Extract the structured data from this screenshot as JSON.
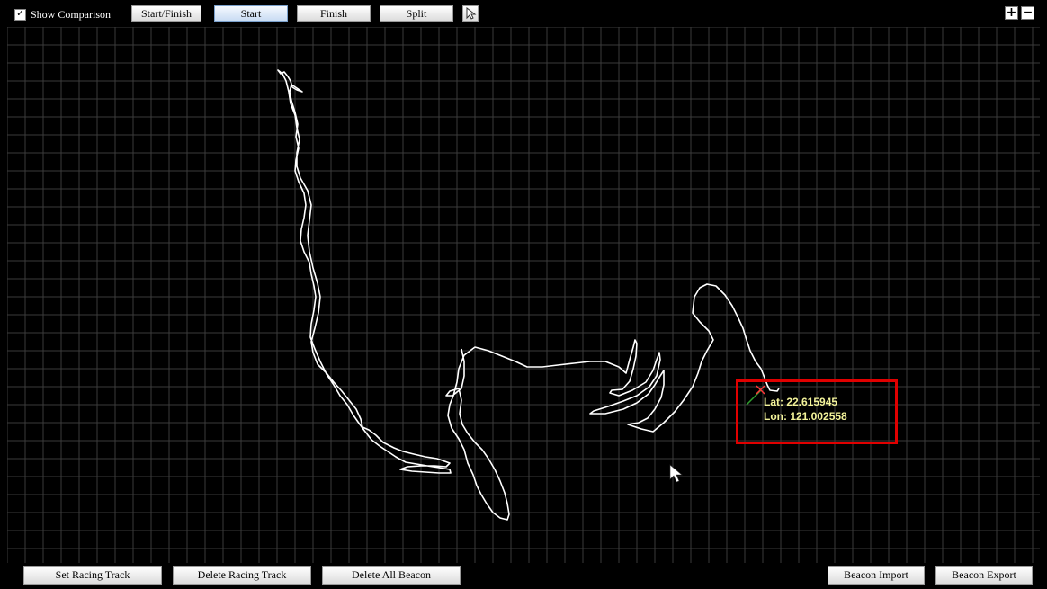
{
  "toolbar": {
    "show_comparison": {
      "label": "Show Comparison",
      "checked": true
    },
    "buttons": {
      "start_finish": "Start/Finish",
      "start": "Start",
      "finish": "Finish",
      "split": "Split"
    },
    "active_button": "Start",
    "zoom_in_icon": "plus-icon",
    "zoom_out_icon": "minus-icon",
    "pointer_tool_icon": "arrow-cursor-icon"
  },
  "map": {
    "grid": true,
    "background": "#000000",
    "grid_color": "#3a3a3a",
    "track_color": "#ffffff",
    "selection_box_color": "#e00000",
    "coords": {
      "lat": "Lat: 22.615945",
      "lon": "Lon: 121.002558"
    }
  },
  "bottom_bar": {
    "set_racing_track": "Set Racing Track",
    "delete_racing_track": "Delete Racing Track",
    "delete_all_beacon": "Delete All Beacon",
    "beacon_import": "Beacon Import",
    "beacon_export": "Beacon Export"
  }
}
